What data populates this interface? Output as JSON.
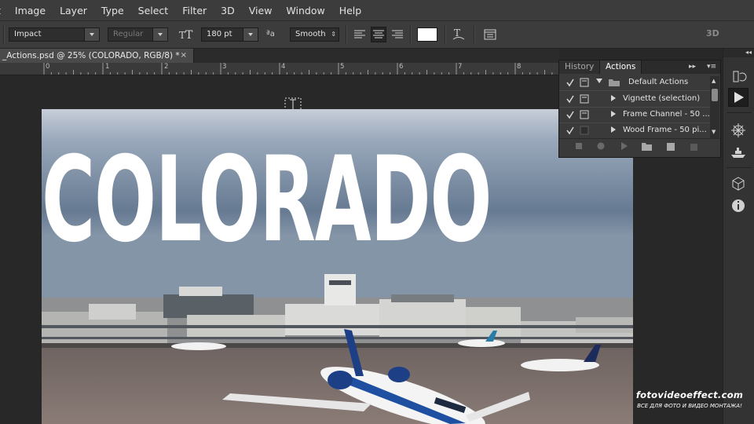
{
  "menu": [
    "t",
    "Image",
    "Layer",
    "Type",
    "Select",
    "Filter",
    "3D",
    "View",
    "Window",
    "Help"
  ],
  "options": {
    "font_family": "Impact",
    "font_style": "Regular",
    "font_size": "180 pt",
    "aa_label": "ªa",
    "anti_alias": "Smooth",
    "text_color": "#ffffff",
    "three_d": "3D"
  },
  "document": {
    "tab_title": "_Actions.psd @ 25% (COLORADO, RGB/8) *",
    "close": "×",
    "heading": "COLORADO"
  },
  "ruler": [
    "0",
    "1",
    "2",
    "3",
    "4",
    "5",
    "6",
    "7",
    "8"
  ],
  "panel": {
    "tabs": [
      "History",
      "Actions"
    ],
    "rows": [
      {
        "label": "Default Actions",
        "checked": true
      },
      {
        "label": "Vignette (selection)",
        "checked": true
      },
      {
        "label": "Frame Channel - 50 ...",
        "checked": true
      },
      {
        "label": "Wood Frame - 50 pi...",
        "checked": true
      }
    ]
  },
  "watermark": {
    "site": "fotovideoeffect.com",
    "tagline": "ВСЕ ДЛЯ ФОТО И ВИДЕО МОНТАЖА!"
  },
  "colors": {
    "accent": "#3c3c3c",
    "panel_bg": "#3a3a3a"
  }
}
